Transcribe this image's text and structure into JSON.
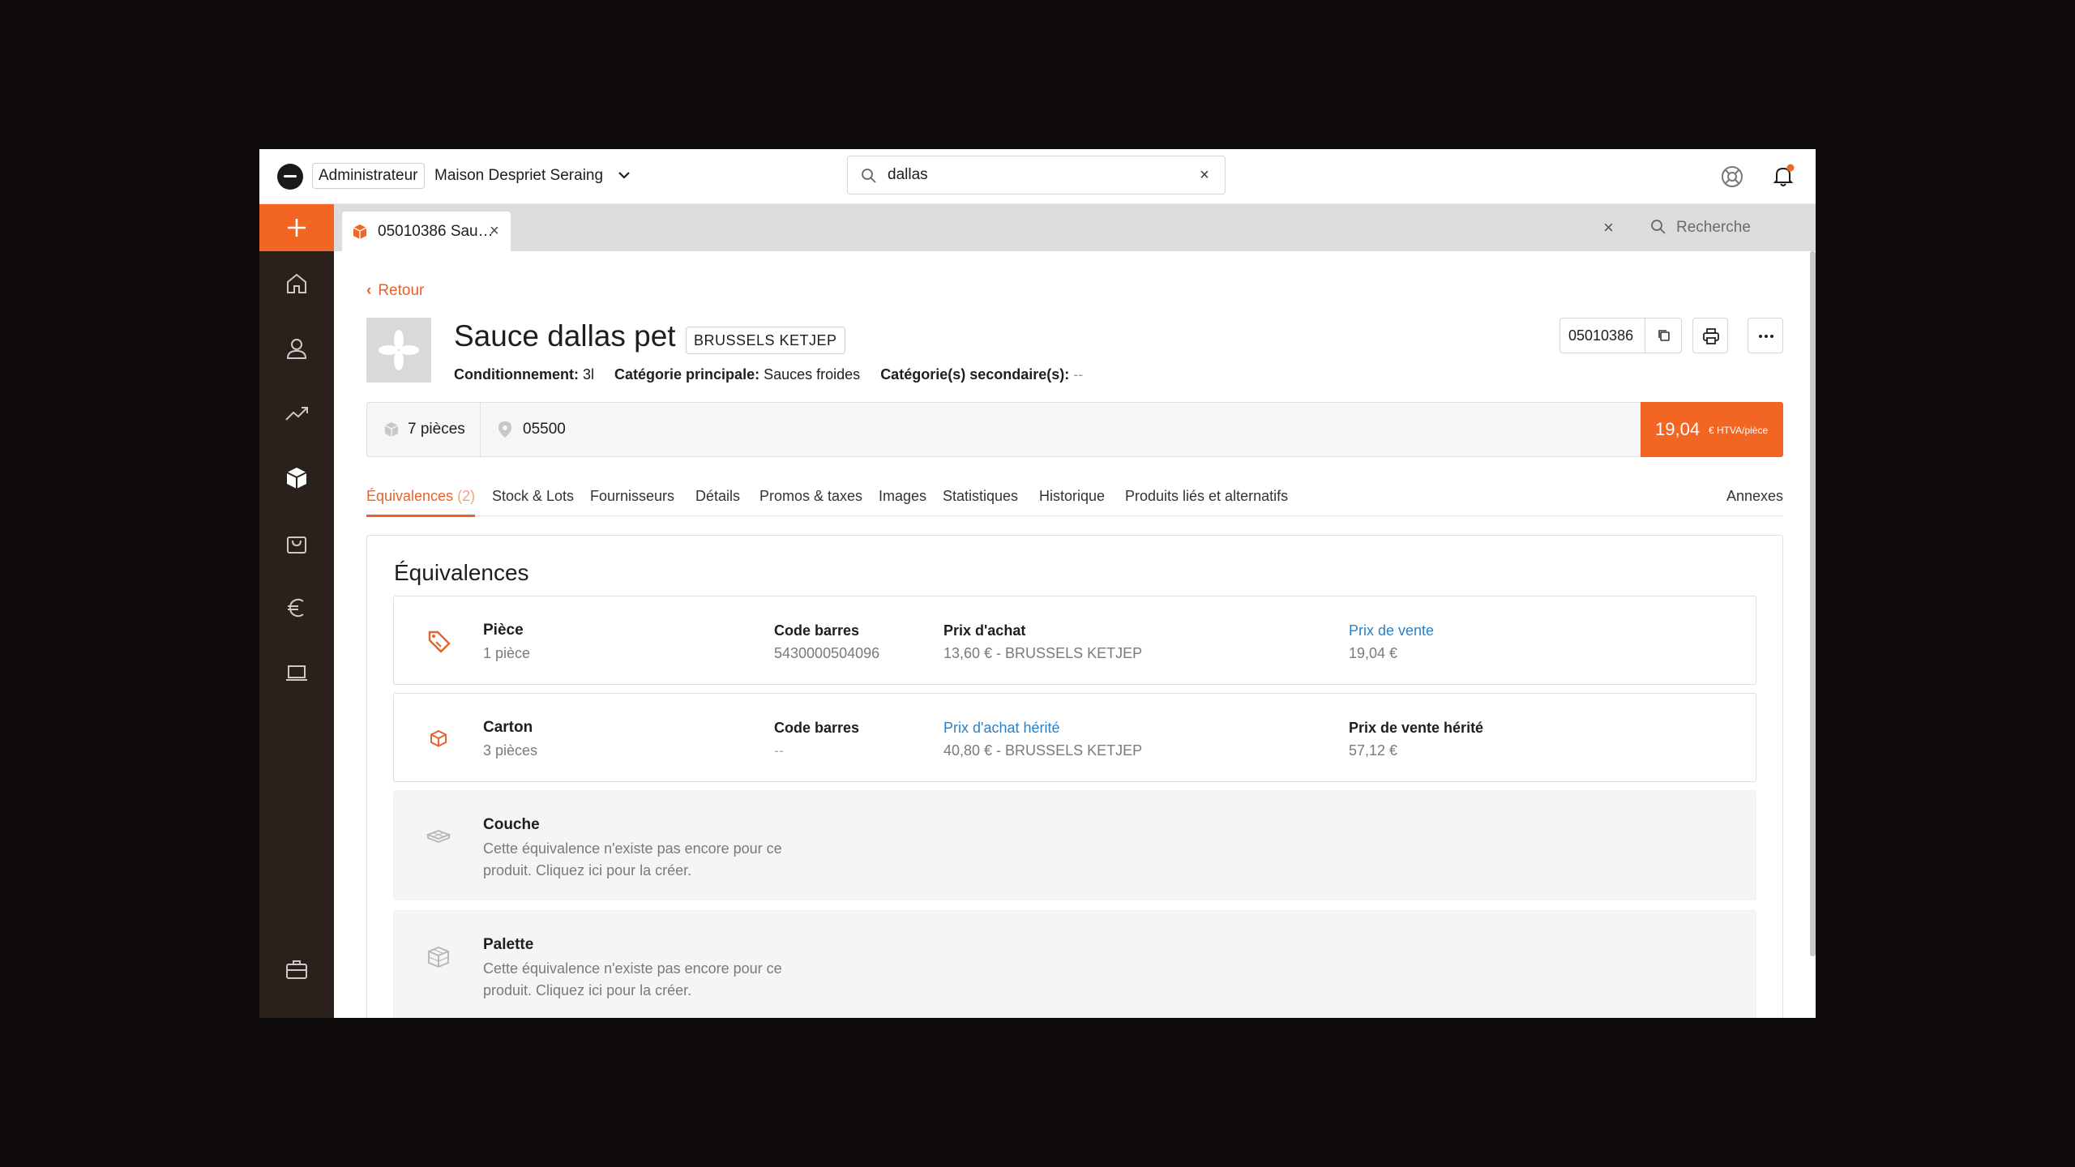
{
  "topbar": {
    "role_badge": "Administrateur",
    "company": "Maison Despriet Seraing",
    "search_value": "dallas",
    "search_clear": "×"
  },
  "tabstrip": {
    "tab_label": "05010386 Sau…",
    "tab_close": "×",
    "close_all": "×",
    "search_placeholder": "Recherche"
  },
  "product": {
    "back_label": "Retour",
    "title": "Sauce dallas pet",
    "brand": "BRUSSELS KETJEP",
    "meta": {
      "conditionnement_label": "Conditionnement:",
      "conditionnement_value": "3l",
      "categorie_label": "Catégorie principale:",
      "categorie_value": "Sauces froides",
      "secondaire_label": "Catégorie(s) secondaire(s):",
      "secondaire_value": "--"
    },
    "code": "05010386",
    "stock_qty": "7 pièces",
    "location": "05500",
    "price_value": "19,04",
    "price_unit": "€ HTVA/pièce"
  },
  "tabs": [
    {
      "label": "Équivalences",
      "count": "(2)"
    },
    {
      "label": "Stock & Lots"
    },
    {
      "label": "Fournisseurs"
    },
    {
      "label": "Détails"
    },
    {
      "label": "Promos & taxes"
    },
    {
      "label": "Images"
    },
    {
      "label": "Statistiques"
    },
    {
      "label": "Historique"
    },
    {
      "label": "Produits liés et alternatifs"
    },
    {
      "label": "Annexes"
    }
  ],
  "equivalences": {
    "title": "Équivalences",
    "rows": [
      {
        "name": "Pièce",
        "sub": "1 pièce",
        "icon": "tag-icon",
        "barcode_label": "Code barres",
        "barcode_value": "5430000504096",
        "purchase_label": "Prix d'achat",
        "purchase_value": "13,60 € - BRUSSELS KETJEP",
        "sale_label": "Prix de vente",
        "sale_value": "19,04 €"
      },
      {
        "name": "Carton",
        "sub": "3 pièces",
        "icon": "box-icon",
        "barcode_label": "Code barres",
        "barcode_value": "--",
        "purchase_label": "Prix d'achat hérité",
        "purchase_value": "40,80 € - BRUSSELS KETJEP",
        "sale_label": "Prix de vente hérité",
        "sale_value": "57,12 €"
      },
      {
        "name": "Couche",
        "icon": "layer-icon",
        "desc": "Cette équivalence n'existe pas encore pour ce produit. Cliquez ici pour la créer."
      },
      {
        "name": "Palette",
        "icon": "pallet-icon",
        "desc": "Cette équivalence n'existe pas encore pour ce produit. Cliquez ici pour la créer."
      }
    ]
  },
  "colors": {
    "accent": "#f26522",
    "sidebar": "#2a201c",
    "link": "#2d7fc1"
  }
}
